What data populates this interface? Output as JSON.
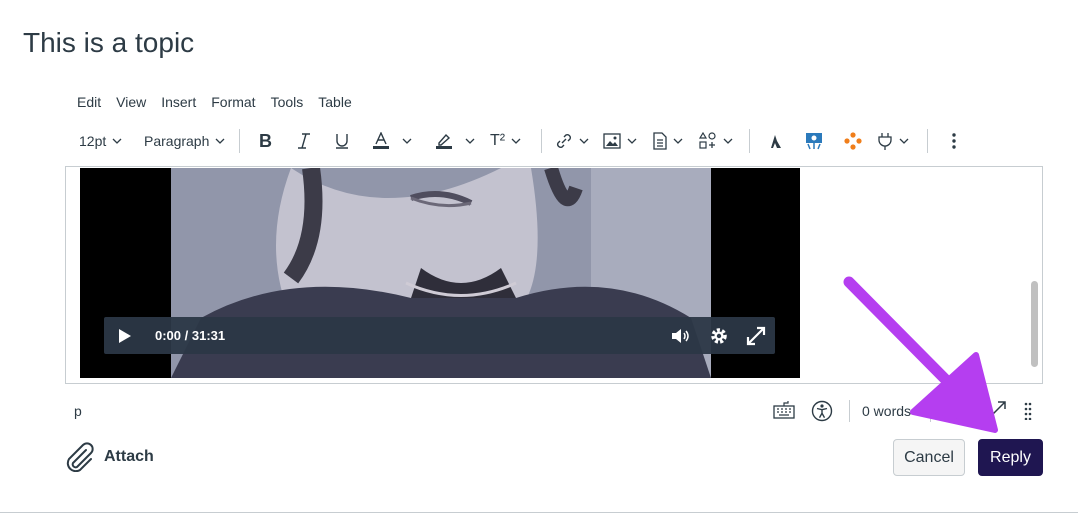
{
  "page": {
    "title": "This is a topic"
  },
  "menubar": {
    "items": [
      "Edit",
      "View",
      "Insert",
      "Format",
      "Tools",
      "Table"
    ]
  },
  "toolbar": {
    "font_size": "12pt",
    "block_format": "Paragraph",
    "superscript_label": "T²",
    "icons": [
      "bold-icon",
      "italic-icon",
      "underline-icon",
      "text-color-icon",
      "highlight-color-icon",
      "superscript-icon",
      "link-icon",
      "image-icon",
      "document-icon",
      "embed-icon",
      "mathtype-icon",
      "media-recorder-icon",
      "apps-icon",
      "plugin-icon",
      "more-options-icon"
    ]
  },
  "video": {
    "time": "0:00 / 31:31"
  },
  "statusbar": {
    "path": "p",
    "word_count": "0 words"
  },
  "actions": {
    "attach_label": "Attach",
    "cancel_label": "Cancel",
    "reply_label": "Reply"
  },
  "colors": {
    "reply_bg": "#1f1651",
    "annotation_arrow": "#b53ef0",
    "text": "#2d3b45"
  }
}
